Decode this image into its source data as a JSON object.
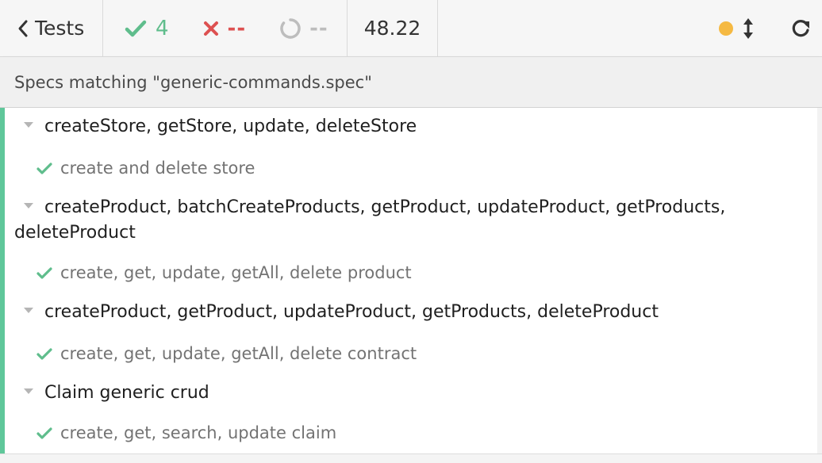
{
  "header": {
    "back_label": "Tests",
    "passed_count": "4",
    "failed_count": "--",
    "pending_count": "--",
    "duration": "48.22",
    "colors": {
      "pass": "#5fbd8c",
      "fail": "#dd5151",
      "pending": "#bdbdbd",
      "status_dot": "#f5b942"
    },
    "icons": {
      "back": "chevron-left-icon",
      "passed": "check-icon",
      "failed": "x-icon",
      "pending": "circle-pending-icon",
      "status": "status-dot-icon",
      "scroll_toggle": "vertical-arrows-icon",
      "reload": "reload-icon"
    }
  },
  "filter": {
    "text": "Specs matching \"generic-commands.spec\""
  },
  "suites": [
    {
      "title": "createStore, getStore, update, deleteStore",
      "tests": [
        "create and delete store"
      ]
    },
    {
      "title": "createProduct, batchCreateProducts, getProduct, updateProduct, getProducts, deleteProduct",
      "tests": [
        "create, get, update, getAll, delete product"
      ]
    },
    {
      "title": "createProduct, getProduct, updateProduct, getProducts, deleteProduct",
      "tests": [
        "create, get, update, getAll, delete contract"
      ]
    },
    {
      "title": "Claim generic crud",
      "tests": [
        "create, get, search, update claim"
      ]
    }
  ],
  "reporter_accent": "#5fc79a"
}
